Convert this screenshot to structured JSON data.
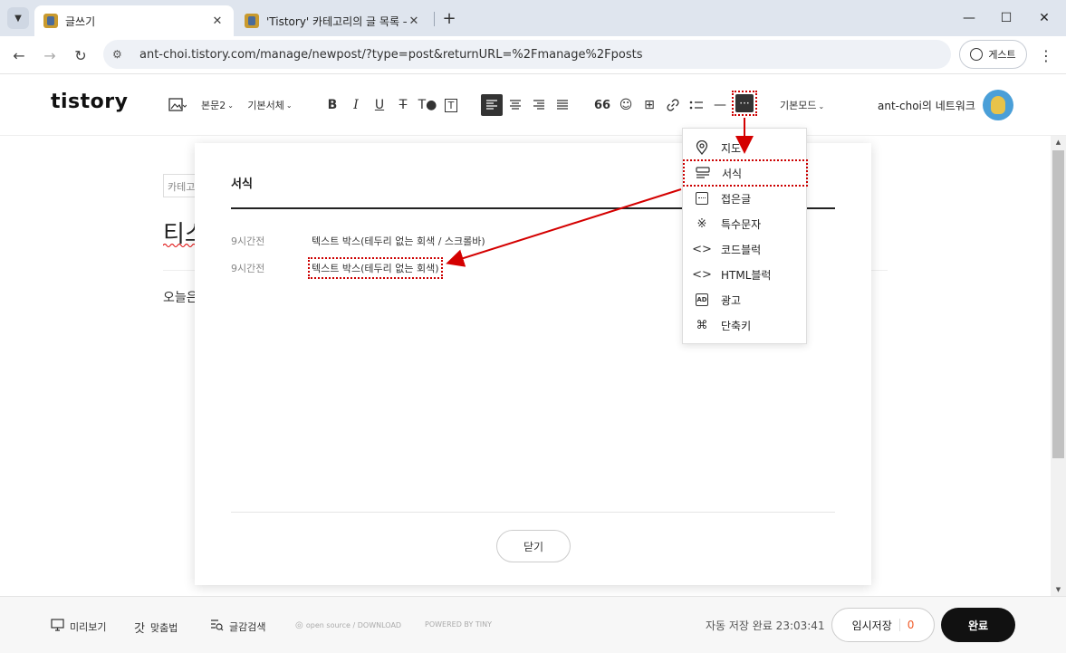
{
  "browser": {
    "tabs": [
      {
        "title": "글쓰기",
        "active": true
      },
      {
        "title": "'Tistory' 카테고리의 글 목록 —",
        "active": false
      }
    ],
    "url": "ant-choi.tistory.com/manage/newpost/?type=post&returnURL=%2Fmanage%2Fposts",
    "profile_label": "게스트"
  },
  "editor": {
    "logo": "tistory",
    "toolbar": {
      "paragraph_style": "본문2",
      "font": "기본서체",
      "mode": "기본모드"
    },
    "blog_name": "ant-choi의 네트워크",
    "category_placeholder": "카테고리",
    "post_title": "티스",
    "body_text": "오늘은"
  },
  "modal": {
    "title": "서식",
    "rows": [
      {
        "time": "9시간전",
        "label": "텍스트 박스(테두리 없는 회색 / 스크롤바)"
      },
      {
        "time": "9시간전",
        "label": "텍스트 박스(테두리 없는 회색)"
      }
    ],
    "close_label": "닫기"
  },
  "dropdown": {
    "items": [
      {
        "label": "지도",
        "icon": "map-pin-icon"
      },
      {
        "label": "서식",
        "icon": "template-icon"
      },
      {
        "label": "접은글",
        "icon": "fold-icon"
      },
      {
        "label": "특수문자",
        "icon": "special-char-icon"
      },
      {
        "label": "코드블럭",
        "icon": "code-icon"
      },
      {
        "label": "HTML블럭",
        "icon": "html-icon"
      },
      {
        "label": "광고",
        "icon": "ad-icon"
      },
      {
        "label": "단축키",
        "icon": "shortcut-icon"
      }
    ]
  },
  "footer": {
    "preview": "미리보기",
    "spellcheck": "맞춤법",
    "search": "글감검색",
    "opensource": "open source / DOWNLOAD",
    "powered": "POWERED BY TINY",
    "autosave": "자동 저장 완료 23:03:41",
    "draft_label": "임시저장",
    "draft_count": "0",
    "publish_label": "완료"
  },
  "colors": {
    "annotation": "#cc0000",
    "accent_orange": "#f05a28",
    "primary_button": "#111111"
  }
}
